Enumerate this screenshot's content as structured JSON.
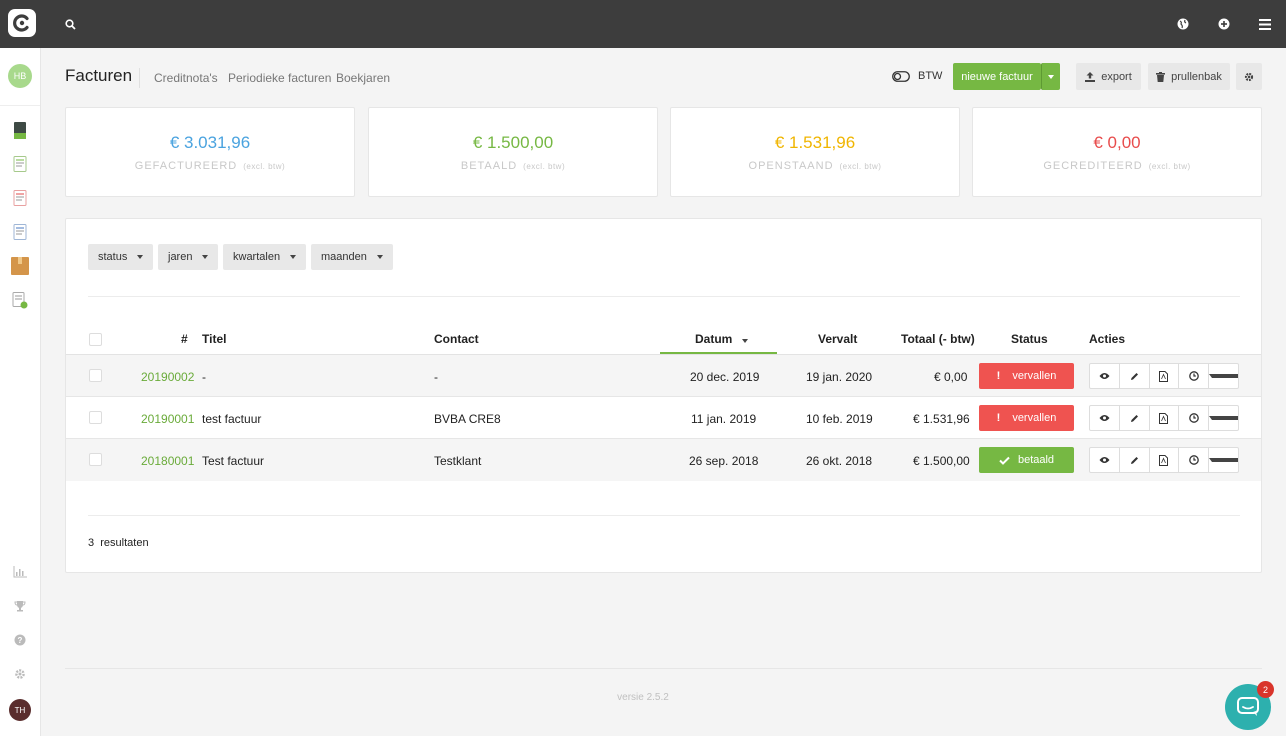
{
  "header": {
    "title": "Facturen",
    "tabs": [
      "Creditnota's",
      "Periodieke facturen",
      "Boekjaren"
    ],
    "btw_toggle_label": "BTW",
    "new_invoice_label": "nieuwe factuur",
    "export_label": "export",
    "trash_label": "prullenbak"
  },
  "user": {
    "initials_top": "HB",
    "initials_bottom": "TH"
  },
  "summary": [
    {
      "amount": "€ 3.031,96",
      "label": "GEFACTUREERD",
      "note": "(excl. btw)",
      "color": "#4aa3df"
    },
    {
      "amount": "€ 1.500,00",
      "label": "BETAALD",
      "note": "(excl. btw)",
      "color": "#76b843"
    },
    {
      "amount": "€ 1.531,96",
      "label": "OPENSTAAND",
      "note": "(excl. btw)",
      "color": "#f0b500"
    },
    {
      "amount": "€ 0,00",
      "label": "GECREDITEERD",
      "note": "(excl. btw)",
      "color": "#e84c4c"
    }
  ],
  "filters": [
    "status",
    "jaren",
    "kwartalen",
    "maanden"
  ],
  "table": {
    "headers": {
      "num": "#",
      "title": "Titel",
      "contact": "Contact",
      "date": "Datum",
      "due": "Vervalt",
      "total": "Totaal (- btw)",
      "status": "Status",
      "actions": "Acties"
    },
    "rows": [
      {
        "num": "20190002",
        "title": "-",
        "contact": "-",
        "date": "20 dec. 2019",
        "due": "19 jan. 2020",
        "total": "€ 0,00",
        "status": "vervallen",
        "status_color": "#ef5350"
      },
      {
        "num": "20190001",
        "title": "test factuur",
        "contact": "BVBA CRE8",
        "date": "11 jan. 2019",
        "due": "10 feb. 2019",
        "total": "€ 1.531,96",
        "status": "vervallen",
        "status_color": "#ef5350"
      },
      {
        "num": "20180001",
        "title": "Test factuur",
        "contact": "Testklant",
        "date": "26 sep. 2018",
        "due": "26 okt. 2018",
        "total": "€ 1.500,00",
        "status": "betaald",
        "status_color": "#76b843"
      }
    ]
  },
  "results": {
    "count": "3",
    "label": "resultaten"
  },
  "version": "versie 2.5.2",
  "chat": {
    "badge": "2"
  },
  "colors": {
    "accent_green": "#76b843",
    "topbar": "#3d3d3d",
    "link_green": "#6aab3a"
  }
}
